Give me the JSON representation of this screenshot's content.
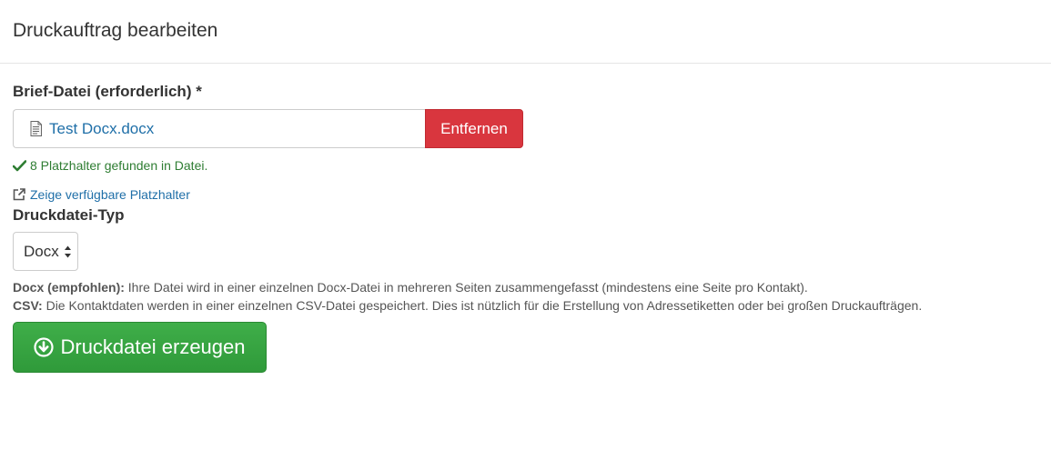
{
  "header": {
    "title": "Druckauftrag bearbeiten"
  },
  "letter_file": {
    "label": "Brief-Datei (erforderlich) *",
    "file_name": "Test Docx.docx",
    "remove_label": "Entfernen",
    "success_message": "8 Platzhalter gefunden in Datei.",
    "show_placeholders_link": "Zeige verfügbare Platzhalter"
  },
  "print_type": {
    "label": "Druckdatei-Typ",
    "selected": "Docx",
    "help": [
      {
        "term": "Docx (empfohlen):",
        "text": " Ihre Datei wird in einer einzelnen Docx-Datei in mehreren Seiten zusammengefasst (mindestens eine Seite pro Kontakt)."
      },
      {
        "term": "CSV:",
        "text": " Die Kontaktdaten werden in einer einzelnen CSV-Datei gespeichert. Dies ist nützlich für die Erstellung von Adressetiketten oder bei großen Druckaufträgen."
      }
    ]
  },
  "actions": {
    "generate_label": "Druckdatei erzeugen"
  },
  "colors": {
    "danger": "#d9363e",
    "success": "#2f9a3a",
    "link": "#1f6fa8",
    "success_text": "#2e7d32"
  }
}
